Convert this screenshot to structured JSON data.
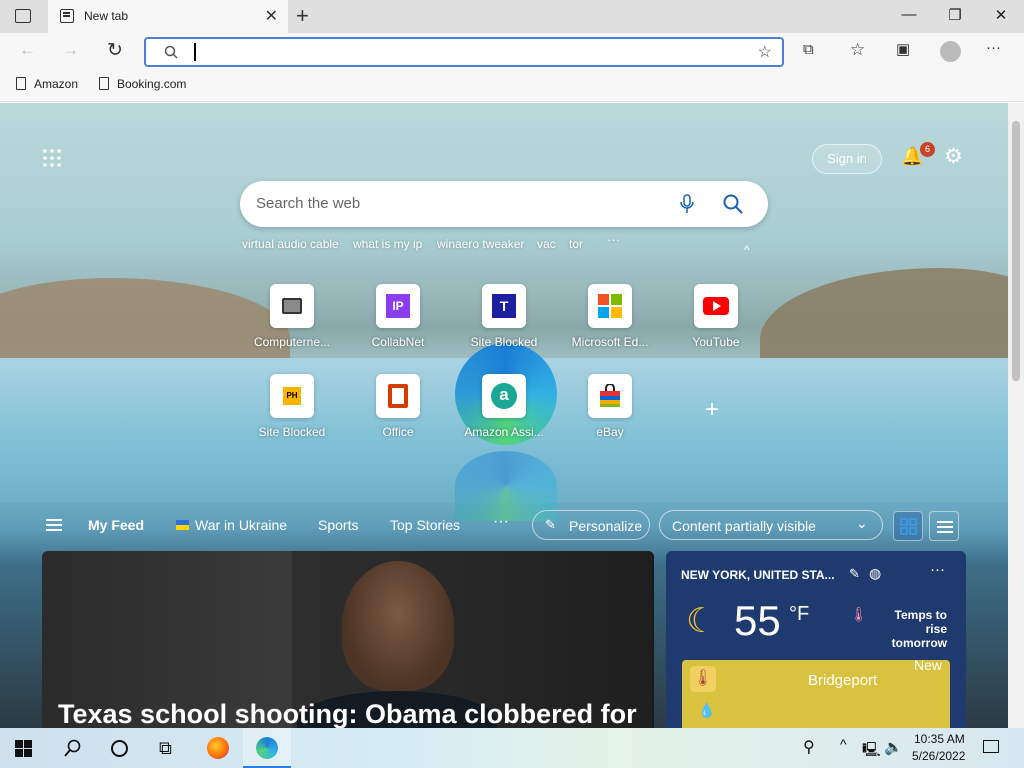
{
  "tab": {
    "title": "New tab",
    "close": "✕",
    "new": "+"
  },
  "window": {
    "minimize": "—",
    "restore": "❐",
    "close": "✕"
  },
  "toolbar": {
    "back": "←",
    "forward": "→",
    "refresh": "↻",
    "menu": "···"
  },
  "bookmarks": [
    {
      "label": "Amazon"
    },
    {
      "label": "Booking.com"
    }
  ],
  "newtab": {
    "sign_in": "Sign in",
    "notifications_count": "6",
    "search_placeholder": "Search the web",
    "suggestions": [
      "virtual audio cable",
      "what is my ip",
      "winaero tweaker",
      "vac",
      "tor"
    ],
    "more": "···",
    "tiles": [
      {
        "label": "Computerne...",
        "icon": "computer-icon"
      },
      {
        "label": "CollabNet",
        "icon": "ip-icon",
        "glyph": "IP"
      },
      {
        "label": "Site Blocked",
        "icon": "t-icon",
        "glyph": "T"
      },
      {
        "label": "Microsoft Ed...",
        "icon": "microsoft-icon"
      },
      {
        "label": "YouTube",
        "icon": "youtube-icon"
      },
      {
        "label": "Site Blocked",
        "icon": "ph-icon",
        "glyph": "PH"
      },
      {
        "label": "Office",
        "icon": "office-icon"
      },
      {
        "label": "Amazon Assi...",
        "icon": "amazon-icon",
        "glyph": "a"
      },
      {
        "label": "eBay",
        "icon": "shopping-bag-icon"
      }
    ],
    "add_tile": "+"
  },
  "feed": {
    "my_feed": "My Feed",
    "war": "War in Ukraine",
    "sports": "Sports",
    "top_stories": "Top Stories",
    "more": "···",
    "personalize": "Personalize",
    "content_visibility": "Content partially visible",
    "hero_headline": "Texas school shooting: Obama clobbered for"
  },
  "weather": {
    "location": "NEW YORK, UNITED STA...",
    "temp": "55",
    "unit": "°F",
    "forecast": "Temps to rise tomorrow",
    "map_city": "Bridgeport",
    "map_city2": "New"
  },
  "taskbar": {
    "time": "10:35 AM",
    "date": "5/26/2022"
  }
}
